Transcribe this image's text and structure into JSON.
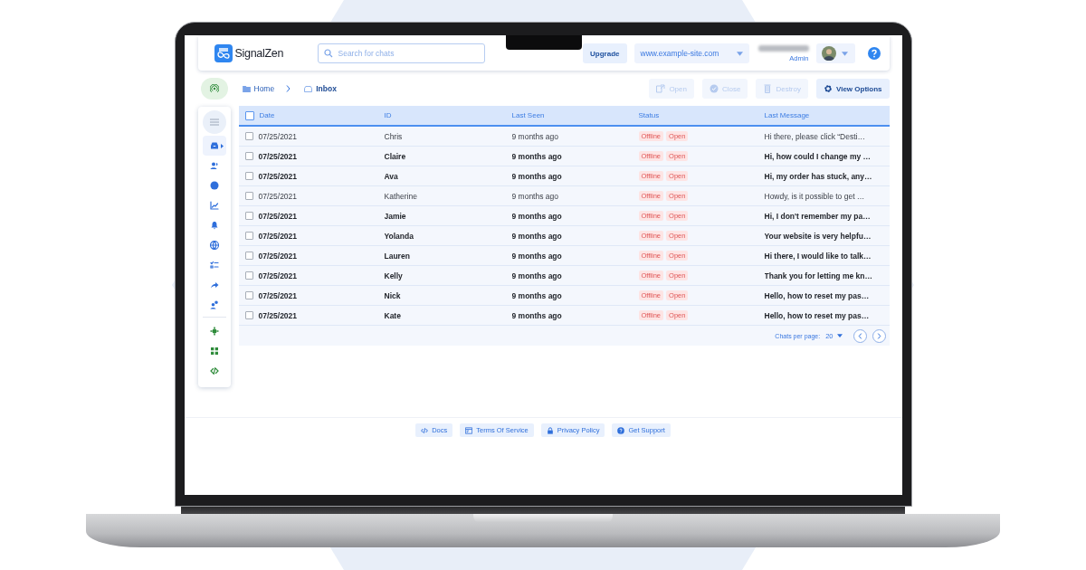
{
  "header": {
    "logo": "SignalZen",
    "search": {
      "placeholder": "Search for chats"
    },
    "upgrade": "Upgrade",
    "site": "www.example-site.com",
    "role": "Admin"
  },
  "sidebar": {
    "items": [
      {
        "selected": true
      },
      {
        "selected": false
      },
      {
        "selected": false
      },
      {
        "selected": false
      },
      {
        "selected": false
      },
      {
        "selected": false
      },
      {
        "selected": false
      },
      {
        "selected": false
      },
      {
        "selected": false
      },
      {
        "selected": false
      },
      {
        "selected": false
      },
      {
        "selected": false
      }
    ]
  },
  "breadcrumbs": [
    {
      "label": "Home",
      "selected": false
    },
    {
      "label": "Inbox",
      "selected": true
    }
  ],
  "actions": [
    {
      "label": "Open",
      "disabled": true
    },
    {
      "label": "Close",
      "disabled": true
    },
    {
      "label": "Destroy",
      "disabled": true
    },
    {
      "label": "View Options",
      "disabled": false
    }
  ],
  "table": {
    "header_checked": false,
    "columns": [
      "Date",
      "ID",
      "Last Seen",
      "Status",
      "Last Message"
    ],
    "rows": [
      {
        "checked": false,
        "unread": false,
        "date": "07/25/2021",
        "id": "Chris",
        "last_seen": "9 months ago",
        "status": [
          "Offline",
          "Open"
        ],
        "last_message": "Hi there, please click “Desti…"
      },
      {
        "checked": false,
        "unread": true,
        "date": "07/25/2021",
        "id": "Claire",
        "last_seen": "9 months ago",
        "status": [
          "Offline",
          "Open"
        ],
        "last_message": "Hi, how could I change my …"
      },
      {
        "checked": false,
        "unread": true,
        "date": "07/25/2021",
        "id": "Ava",
        "last_seen": "9 months ago",
        "status": [
          "Offline",
          "Open"
        ],
        "last_message": "Hi, my order has stuck, any…"
      },
      {
        "checked": false,
        "unread": false,
        "date": "07/25/2021",
        "id": "Katherine",
        "last_seen": "9 months ago",
        "status": [
          "Offline",
          "Open"
        ],
        "last_message": "Howdy, is it possible to get …"
      },
      {
        "checked": false,
        "unread": true,
        "date": "07/25/2021",
        "id": "Jamie",
        "last_seen": "9 months ago",
        "status": [
          "Offline",
          "Open"
        ],
        "last_message": "Hi, I don't remember my pa…"
      },
      {
        "checked": false,
        "unread": true,
        "date": "07/25/2021",
        "id": "Yolanda",
        "last_seen": "9 months ago",
        "status": [
          "Offline",
          "Open"
        ],
        "last_message": "Your website is very helpfu…"
      },
      {
        "checked": false,
        "unread": true,
        "date": "07/25/2021",
        "id": "Lauren",
        "last_seen": "9 months ago",
        "status": [
          "Offline",
          "Open"
        ],
        "last_message": "Hi there, I would like to talk…"
      },
      {
        "checked": false,
        "unread": true,
        "date": "07/25/2021",
        "id": "Kelly",
        "last_seen": "9 months ago",
        "status": [
          "Offline",
          "Open"
        ],
        "last_message": "Thank you for letting me kn…"
      },
      {
        "checked": false,
        "unread": true,
        "date": "07/25/2021",
        "id": "Nick",
        "last_seen": "9 months ago",
        "status": [
          "Offline",
          "Open"
        ],
        "last_message": "Hello, how to reset my pas…"
      },
      {
        "checked": false,
        "unread": true,
        "date": "07/25/2021",
        "id": "Kate",
        "last_seen": "9 months ago",
        "status": [
          "Offline",
          "Open"
        ],
        "last_message": "Hello, how to reset my pas…"
      }
    ],
    "per_page_label": "Chats per page:",
    "per_page": "20"
  },
  "footer": [
    "Docs",
    "Terms Of Service",
    "Privacy Policy",
    "Get Support"
  ]
}
